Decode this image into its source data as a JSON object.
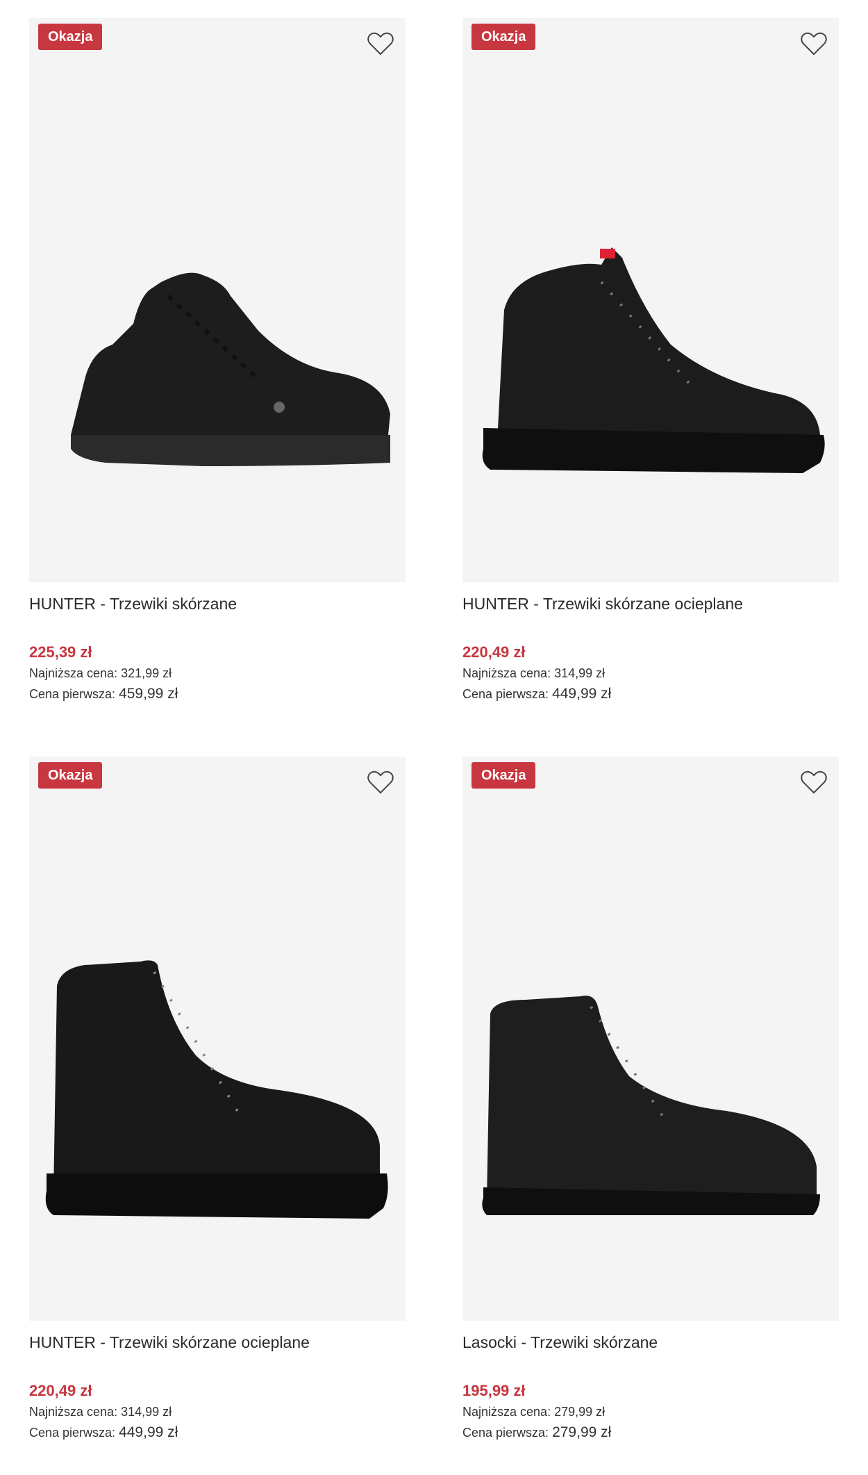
{
  "colors": {
    "badge": "#c8363f",
    "price": "#c8363f",
    "image_bg": "#f4f4f4"
  },
  "products": [
    {
      "badge": "Okazja",
      "title": "HUNTER - Trzewiki skórzane",
      "price": "225,39 zł",
      "lowest_label": "Najniższa cena:",
      "lowest_value": "321,99 zł",
      "original_label": "Cena pierwsza:",
      "original_value": "459,99 zł",
      "image": "black-hiking-boot"
    },
    {
      "badge": "Okazja",
      "title": "HUNTER - Trzewiki skórzane ocieplane",
      "price": "220,49 zł",
      "lowest_label": "Najniższa cena:",
      "lowest_value": "314,99 zł",
      "original_label": "Cena pierwsza:",
      "original_value": "449,99 zł",
      "image": "black-lace-up-ankle-boot"
    },
    {
      "badge": "Okazja",
      "title": "HUNTER - Trzewiki skórzane ocieplane",
      "price": "220,49 zł",
      "lowest_label": "Najniższa cena:",
      "lowest_value": "314,99 zł",
      "original_label": "Cena pierwsza:",
      "original_value": "449,99 zł",
      "image": "black-high-combat-boot"
    },
    {
      "badge": "Okazja",
      "title": "Lasocki - Trzewiki skórzane",
      "price": "195,99 zł",
      "lowest_label": "Najniższa cena:",
      "lowest_value": "279,99 zł",
      "original_label": "Cena pierwsza:",
      "original_value": "279,99 zł",
      "image": "black-leather-zip-boot"
    }
  ]
}
